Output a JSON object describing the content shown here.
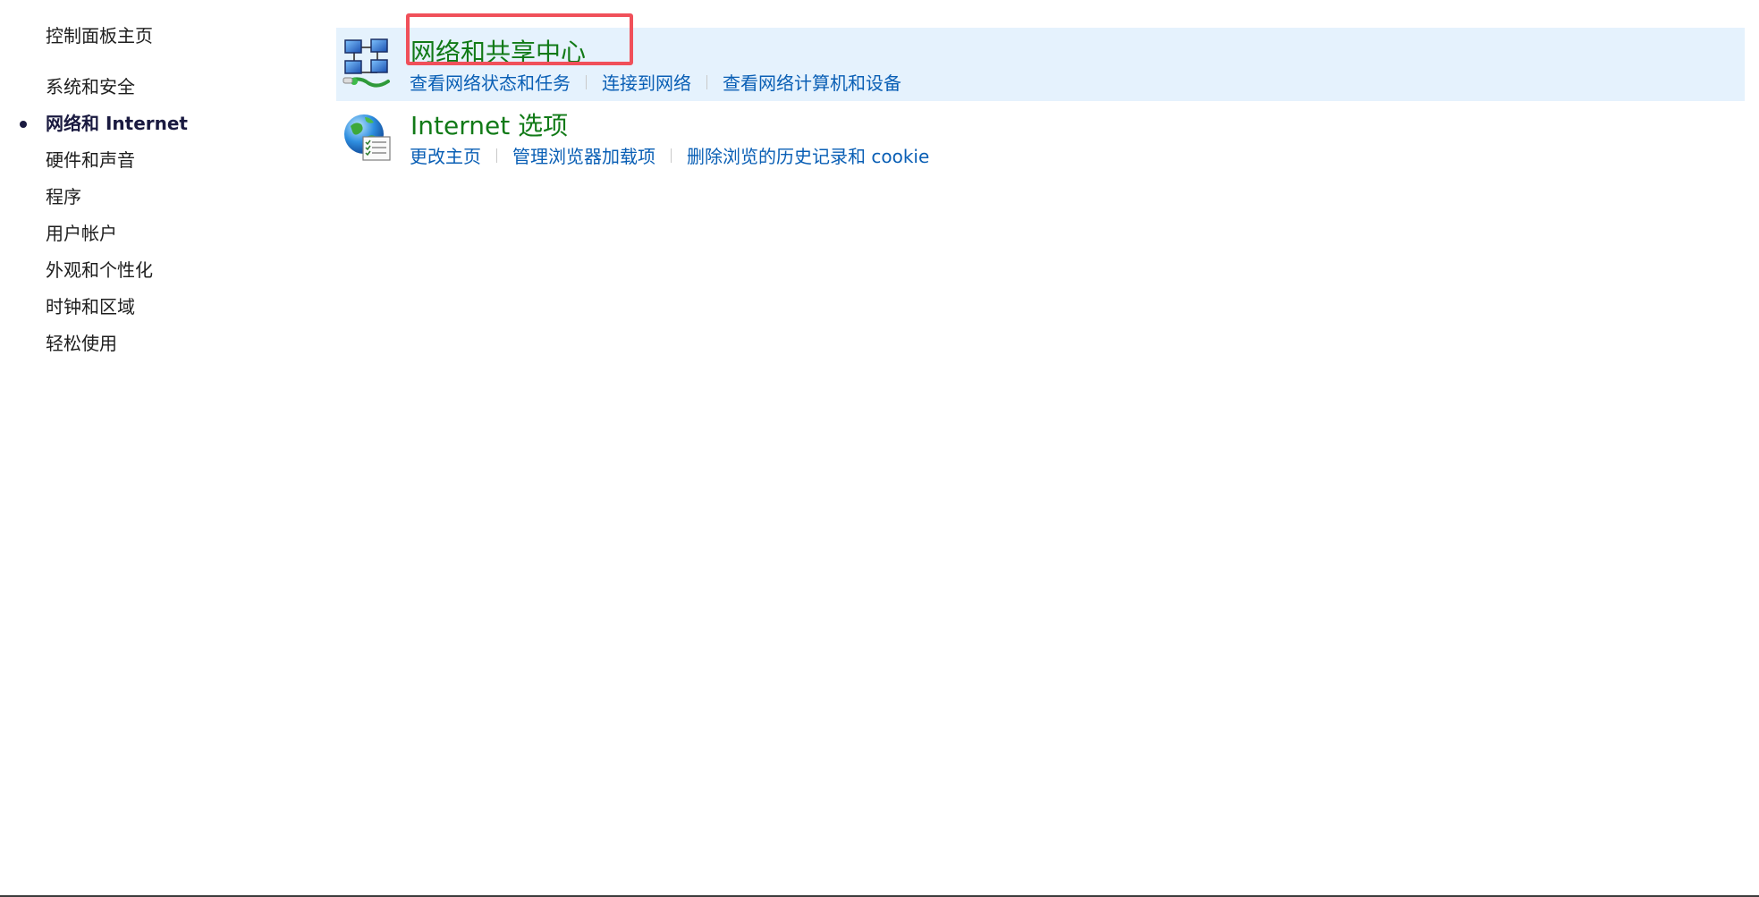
{
  "sidebar": {
    "home_label": "控制面板主页",
    "items": [
      {
        "label": "系统和安全",
        "active": false
      },
      {
        "label": "网络和 Internet",
        "active": true
      },
      {
        "label": "硬件和声音",
        "active": false
      },
      {
        "label": "程序",
        "active": false
      },
      {
        "label": "用户帐户",
        "active": false
      },
      {
        "label": "外观和个性化",
        "active": false
      },
      {
        "label": "时钟和区域",
        "active": false
      },
      {
        "label": "轻松使用",
        "active": false
      }
    ]
  },
  "categories": [
    {
      "title": "网络和共享中心",
      "icon": "network-sharing-center-icon",
      "highlighted": true,
      "links": [
        "查看网络状态和任务",
        "连接到网络",
        "查看网络计算机和设备"
      ]
    },
    {
      "title": "Internet 选项",
      "icon": "internet-options-icon",
      "highlighted": false,
      "links": [
        "更改主页",
        "管理浏览器加载项",
        "删除浏览的历史记录和 cookie"
      ]
    }
  ],
  "colors": {
    "highlight_bg": "#e5f2fd",
    "title_green": "#117a17",
    "link_blue": "#0a5fb5",
    "focus_box": "#f0505a"
  }
}
